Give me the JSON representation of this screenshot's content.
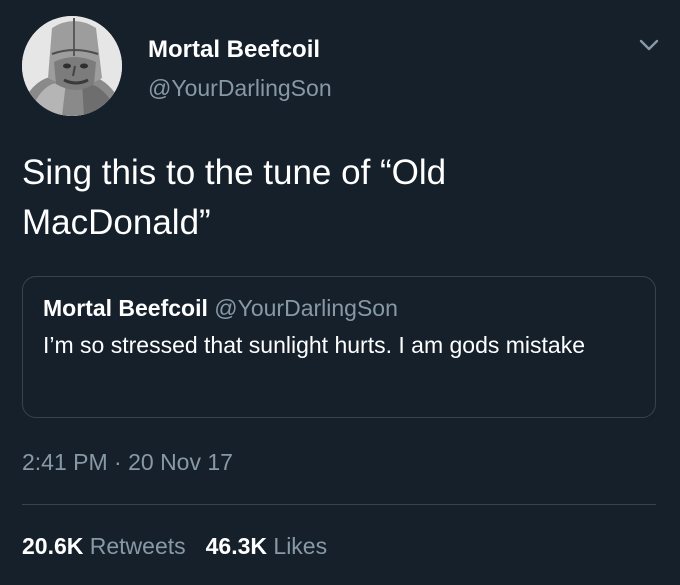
{
  "tweet": {
    "display_name": "Mortal Beefcoil",
    "handle": "@YourDarlingSon",
    "text": "Sing this to the tune of “Old MacDonald”",
    "timestamp": "2:41 PM · 20 Nov 17",
    "avatar_icon": "medieval-helmet-portrait",
    "menu_icon": "chevron-down-icon"
  },
  "quoted_tweet": {
    "display_name": "Mortal Beefcoil",
    "handle": "@YourDarlingSon",
    "text": "I’m so stressed that sunlight hurts. I am gods mistake"
  },
  "stats": {
    "retweets_count": "20.6K",
    "retweets_label": "Retweets",
    "likes_count": "46.3K",
    "likes_label": "Likes"
  },
  "colors": {
    "background": "#15202b",
    "primary_text": "#ffffff",
    "secondary_text": "#8899a6",
    "border": "#38444d"
  }
}
